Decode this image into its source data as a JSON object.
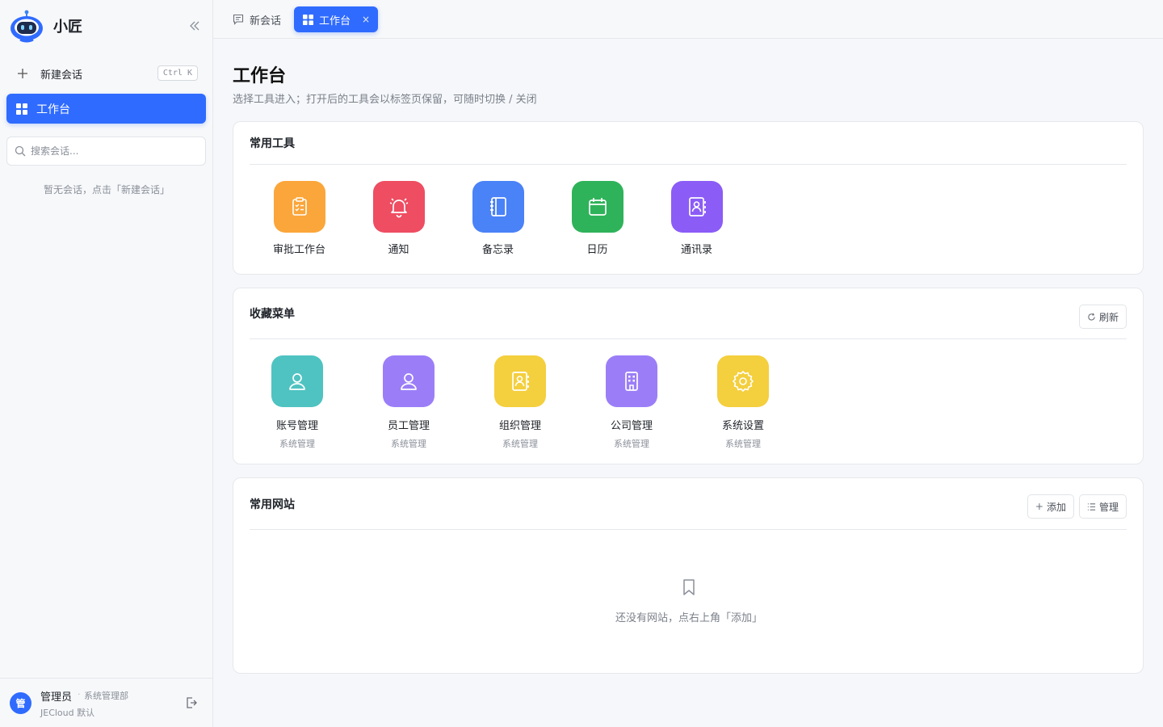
{
  "brand": {
    "name": "小匠"
  },
  "sidebar": {
    "new_chat_label": "新建会话",
    "new_chat_shortcut": "Ctrl K",
    "nav_active_label": "工作台",
    "search_placeholder": "搜索会话...",
    "empty_text": "暂无会话，点击「新建会话」"
  },
  "user": {
    "avatar_text": "管",
    "name": "管理员",
    "separator": "·",
    "dept": "系统管理部",
    "org": "JECloud 默认"
  },
  "tabs": [
    {
      "label": "新会话",
      "active": false
    },
    {
      "label": "工作台",
      "active": true,
      "close": "×"
    }
  ],
  "page": {
    "title": "工作台",
    "desc": "选择工具进入；打开后的工具会以标签页保留，可随时切换 / 关闭"
  },
  "common_tools": {
    "title": "常用工具",
    "items": [
      {
        "label": "审批工作台",
        "icon": "clipboard-check-icon",
        "color": "#fba63a"
      },
      {
        "label": "通知",
        "icon": "bell-icon",
        "color": "#ee4d62"
      },
      {
        "label": "备忘录",
        "icon": "notebook-icon",
        "color": "#4a82f7"
      },
      {
        "label": "日历",
        "icon": "calendar-icon",
        "color": "#2fb35a"
      },
      {
        "label": "通讯录",
        "icon": "contact-book-icon",
        "color": "#8b5cf6"
      }
    ]
  },
  "favorites": {
    "title": "收藏菜单",
    "refresh_label": "刷新",
    "items": [
      {
        "label": "账号管理",
        "sub": "系统管理",
        "icon": "user-icon",
        "color": "#4fc3c1"
      },
      {
        "label": "员工管理",
        "sub": "系统管理",
        "icon": "user-icon",
        "color": "#9b7ef7"
      },
      {
        "label": "组织管理",
        "sub": "系统管理",
        "icon": "contact-book-icon",
        "color": "#f4cf3e"
      },
      {
        "label": "公司管理",
        "sub": "系统管理",
        "icon": "building-icon",
        "color": "#9b7ef7"
      },
      {
        "label": "系统设置",
        "sub": "系统管理",
        "icon": "gear-icon",
        "color": "#f4cf3e"
      }
    ]
  },
  "websites": {
    "title": "常用网站",
    "add_label": "添加",
    "manage_label": "管理",
    "empty_text": "还没有网站，点右上角「添加」"
  },
  "colors": {
    "accent": "#2f6bff"
  }
}
